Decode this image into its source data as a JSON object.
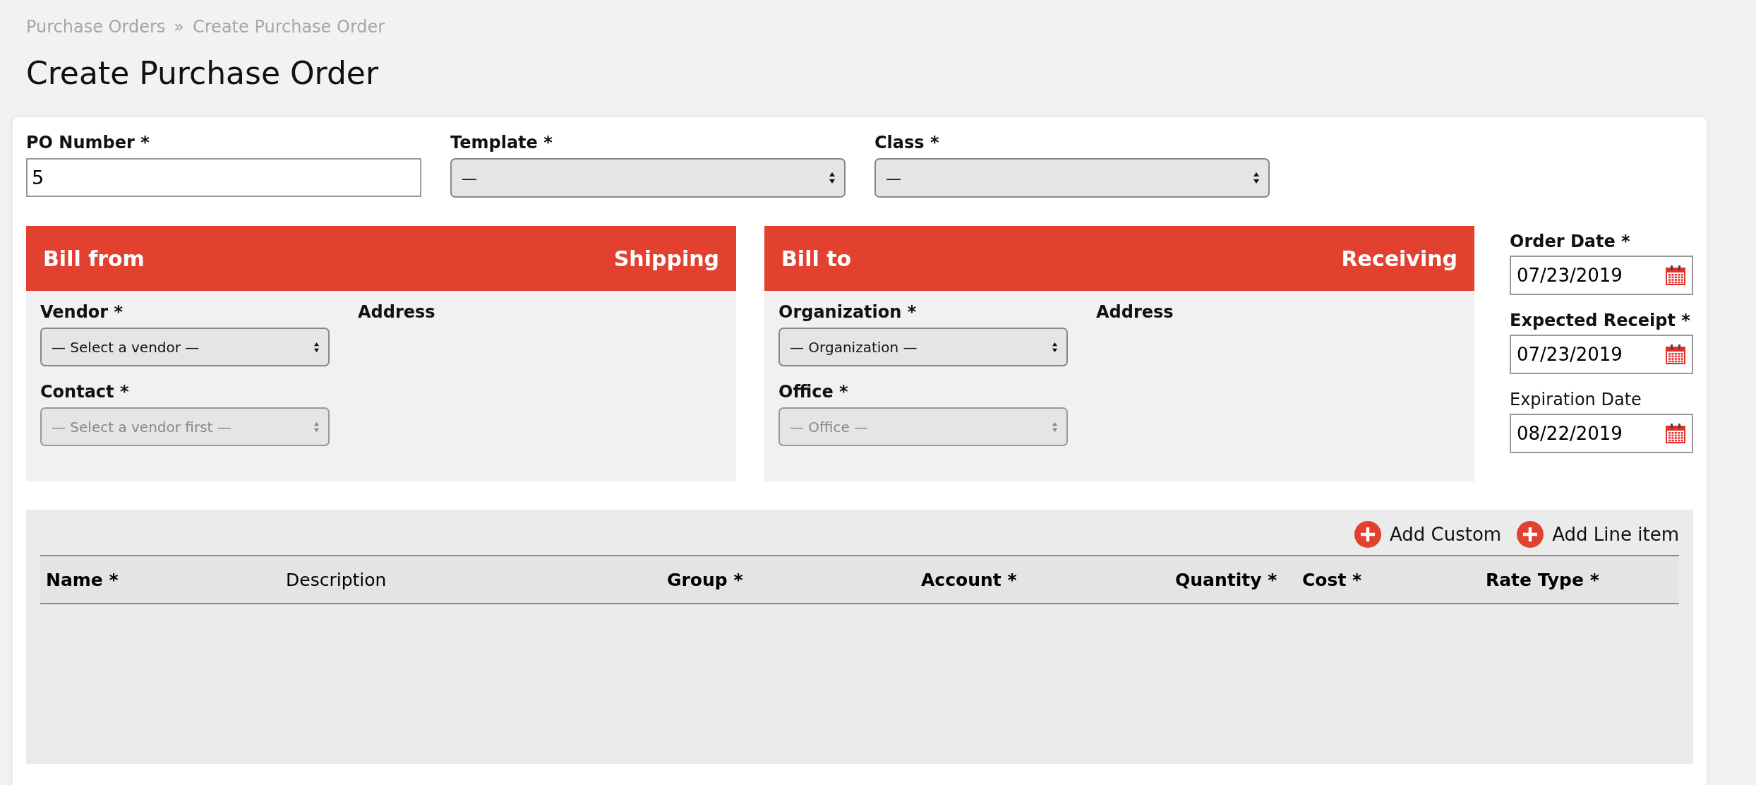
{
  "breadcrumb": {
    "items": [
      {
        "label": "Purchase Orders"
      },
      {
        "label": "Create Purchase Order"
      }
    ],
    "separator": "»"
  },
  "title": "Create Purchase Order",
  "top_fields": [
    {
      "kind": "input",
      "label": "PO Number *",
      "value": "5"
    },
    {
      "kind": "select",
      "label": "Template *",
      "value": "—"
    },
    {
      "kind": "select",
      "label": "Class *",
      "value": "—"
    }
  ],
  "panels": [
    {
      "title": "Bill from",
      "side_title": "Shipping",
      "address_label": "Address",
      "selects": [
        {
          "label": "Vendor *",
          "value": "— Select a vendor —",
          "disabled": false
        },
        {
          "label": "Contact *",
          "value": "— Select a vendor first —",
          "disabled": true
        }
      ]
    },
    {
      "title": "Bill to",
      "side_title": "Receiving",
      "address_label": "Address",
      "selects": [
        {
          "label": "Organization *",
          "value": "— Organization —",
          "disabled": false
        },
        {
          "label": "Office *",
          "value": "— Office —",
          "disabled": true
        }
      ]
    }
  ],
  "dates": [
    {
      "label": "Order Date *",
      "required": true,
      "value": "07/23/2019"
    },
    {
      "label": "Expected Receipt *",
      "required": true,
      "value": "07/23/2019"
    },
    {
      "label": "Expiration Date",
      "required": false,
      "value": "08/22/2019"
    }
  ],
  "line_items": {
    "actions": [
      {
        "label": "Add Custom"
      },
      {
        "label": "Add Line item"
      }
    ],
    "columns": [
      {
        "label": "Name *",
        "required": true
      },
      {
        "label": "Description",
        "required": false
      },
      {
        "label": "Group *",
        "required": true
      },
      {
        "label": "Account *",
        "required": true
      },
      {
        "label": "Quantity *",
        "required": true
      },
      {
        "label": "Cost *",
        "required": true
      },
      {
        "label": "Rate Type *",
        "required": true
      }
    ]
  }
}
